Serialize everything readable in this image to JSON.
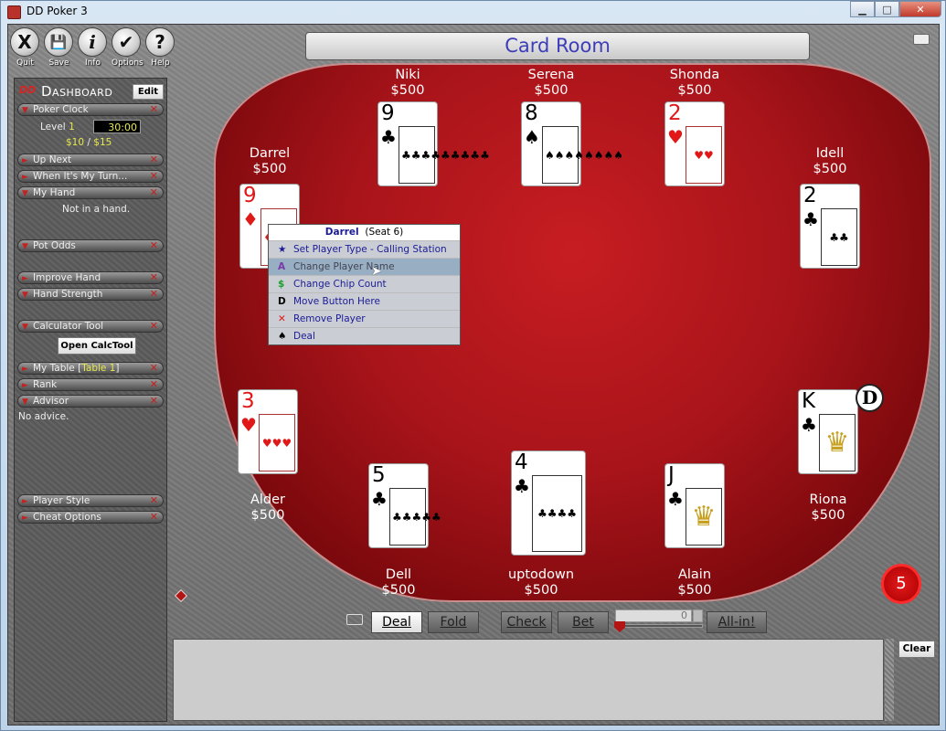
{
  "window": {
    "title": "DD Poker 3",
    "controls": {
      "minimize": "▁",
      "maximize": "□",
      "close": "✕"
    }
  },
  "toolbar": [
    {
      "label": "Quit",
      "icon": "X"
    },
    {
      "label": "Save",
      "icon": "💾"
    },
    {
      "label": "Info",
      "icon": "i"
    },
    {
      "label": "Options",
      "icon": "✔"
    },
    {
      "label": "Help",
      "icon": "?"
    }
  ],
  "dashboard": {
    "logo": "DD",
    "title": "Dashboard",
    "edit_label": "Edit",
    "sections": [
      {
        "label": "Poker Clock",
        "expanded": true
      },
      {
        "label": "Up Next",
        "expanded": false
      },
      {
        "label": "When It's My Turn...",
        "expanded": false
      },
      {
        "label": "My Hand",
        "expanded": true
      },
      {
        "label": "Pot Odds",
        "expanded": true
      },
      {
        "label": "Improve Hand",
        "expanded": false
      },
      {
        "label": "Hand Strength",
        "expanded": true
      },
      {
        "label": "Calculator Tool",
        "expanded": true
      },
      {
        "label": "My Table [",
        "label_extra": "Table 1",
        "label_end": "]",
        "expanded": false
      },
      {
        "label": "Rank",
        "expanded": false
      },
      {
        "label": "Advisor",
        "expanded": true
      },
      {
        "label": "Player Style",
        "expanded": false
      },
      {
        "label": "Cheat Options",
        "expanded": false
      }
    ],
    "clock": {
      "level_label": "Level",
      "level": "1",
      "time": "30:00",
      "small_blind": "$10",
      "sep": "/",
      "big_blind": "$15"
    },
    "my_hand_text": "Not in a hand.",
    "calc_button": "Open CalcTool",
    "advisor_text": "No advice."
  },
  "room": {
    "title": "Card Room"
  },
  "players": [
    {
      "name": "Niki",
      "chips": "$500",
      "card": {
        "rank": "9",
        "suit": "♣",
        "color": "black",
        "pips": "♣♣♣♣♣♣♣♣♣"
      }
    },
    {
      "name": "Serena",
      "chips": "$500",
      "card": {
        "rank": "8",
        "suit": "♠",
        "color": "black",
        "pips": "♠♠♠♠♠♠♠♠"
      }
    },
    {
      "name": "Shonda",
      "chips": "$500",
      "card": {
        "rank": "2",
        "suit": "♥",
        "color": "red",
        "pips": "♥♥"
      }
    },
    {
      "name": "Darrel",
      "chips": "$500",
      "card": {
        "rank": "9",
        "suit": "♦",
        "color": "red",
        "pips": "♦♦♦♦♦♦♦♦♦"
      }
    },
    {
      "name": "Idell",
      "chips": "$500",
      "card": {
        "rank": "2",
        "suit": "♣",
        "color": "black",
        "pips": "♣♣"
      }
    },
    {
      "name": "Alder",
      "chips": "$500",
      "card": {
        "rank": "3",
        "suit": "♥",
        "color": "red",
        "pips": "♥♥♥"
      }
    },
    {
      "name": "Dell",
      "chips": "$500",
      "card": {
        "rank": "5",
        "suit": "♣",
        "color": "black",
        "pips": "♣♣♣♣♣"
      }
    },
    {
      "name": "uptodown",
      "chips": "$500",
      "card": {
        "rank": "4",
        "suit": "♣",
        "color": "black",
        "pips": "♣♣♣♣"
      }
    },
    {
      "name": "Alain",
      "chips": "$500",
      "card": {
        "rank": "J",
        "suit": "♣",
        "color": "black",
        "pips": "♛"
      }
    },
    {
      "name": "Riona",
      "chips": "$500",
      "card": {
        "rank": "K",
        "suit": "♣",
        "color": "black",
        "pips": "♛"
      }
    }
  ],
  "dealer_button": "D",
  "hand_count": "5",
  "context_menu": {
    "player": "Darrel",
    "seat": "(Seat 6)",
    "items": [
      {
        "icon": "★",
        "label": "Set Player Type - Calling Station",
        "color": "#1b1b95"
      },
      {
        "icon": "A",
        "label": "Change Player Name",
        "color": "#7a3aa8",
        "highlighted": true
      },
      {
        "icon": "$",
        "label": "Change Chip Count",
        "color": "#1e9e2e"
      },
      {
        "icon": "D",
        "label": "Move Button Here",
        "color": "#000"
      },
      {
        "icon": "✕",
        "label": "Remove Player",
        "color": "#e01818"
      },
      {
        "icon": "♠",
        "label": "Deal",
        "color": "#000"
      }
    ]
  },
  "actions": {
    "deal": "Deal",
    "fold": "Fold",
    "check": "Check",
    "bet": "Bet",
    "bet_amount": "0",
    "all_in": "All-in!"
  },
  "chat": {
    "clear_label": "Clear",
    "text": ""
  }
}
